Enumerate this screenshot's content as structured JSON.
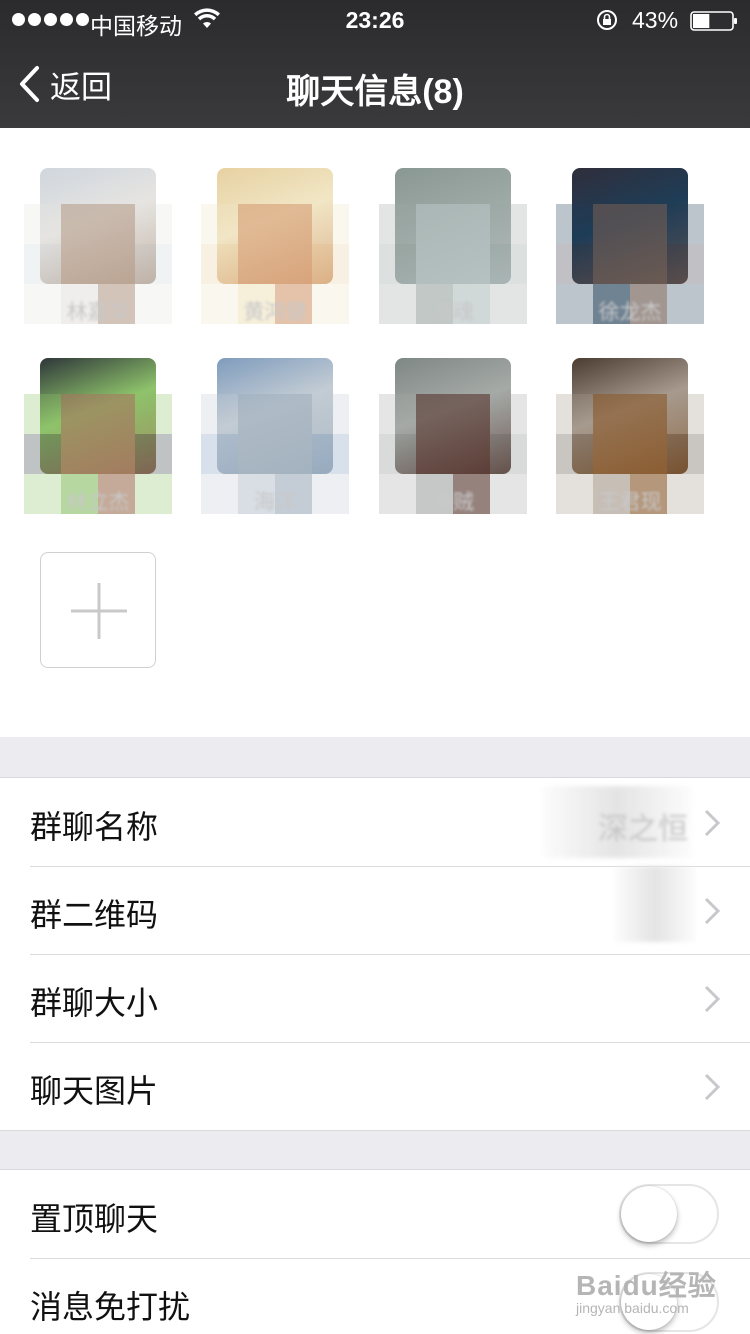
{
  "status_bar": {
    "carrier": "中国移动",
    "time": "23:26",
    "battery_percent": "43%",
    "battery_level": 0.43
  },
  "nav": {
    "back_label": "返回",
    "title": "聊天信息(8)"
  },
  "members": [
    {
      "name": "林嘉华",
      "avatar_colors": [
        "#cfd6de",
        "#b9a391",
        "#e6e4e1"
      ]
    },
    {
      "name": "黄鸿健",
      "avatar_colors": [
        "#e7d1a2",
        "#d7a27a",
        "#f1e6c5"
      ]
    },
    {
      "name": "海魂",
      "avatar_colors": [
        "#8a9893",
        "#b7c1c3",
        "#9da9a5"
      ]
    },
    {
      "name": "徐龙杰",
      "avatar_colors": [
        "#2f2e3b",
        "#6d5b53",
        "#1f3d57"
      ]
    },
    {
      "name": "林立杰",
      "avatar_colors": [
        "#2e3639",
        "#a47a5f",
        "#8ec36b"
      ]
    },
    {
      "name": "海洋",
      "avatar_colors": [
        "#7f9cbd",
        "#a3b2bf",
        "#c3ccd4"
      ]
    },
    {
      "name": "海贼",
      "avatar_colors": [
        "#7f8784",
        "#5b3b34",
        "#a5aaa7"
      ]
    },
    {
      "name": "王君现",
      "avatar_colors": [
        "#4b3c31",
        "#8b5c30",
        "#a79a8e"
      ]
    }
  ],
  "settings_group_1": [
    {
      "label": "群聊名称",
      "value": "深之恒"
    },
    {
      "label": "群二维码",
      "value": ""
    },
    {
      "label": "群聊大小",
      "value": ""
    },
    {
      "label": "聊天图片",
      "value": ""
    }
  ],
  "settings_group_2": [
    {
      "label": "置顶聊天",
      "toggle_on": false
    },
    {
      "label": "消息免打扰",
      "toggle_on": false
    }
  ],
  "watermark": {
    "main": "Baidu经验",
    "sub": "jingyan.baidu.com"
  },
  "colors": {
    "header_bg": "#333335",
    "page_bg": "#ebebf0",
    "separator": "#dcdcdf",
    "chevron": "#c7c7cc"
  }
}
